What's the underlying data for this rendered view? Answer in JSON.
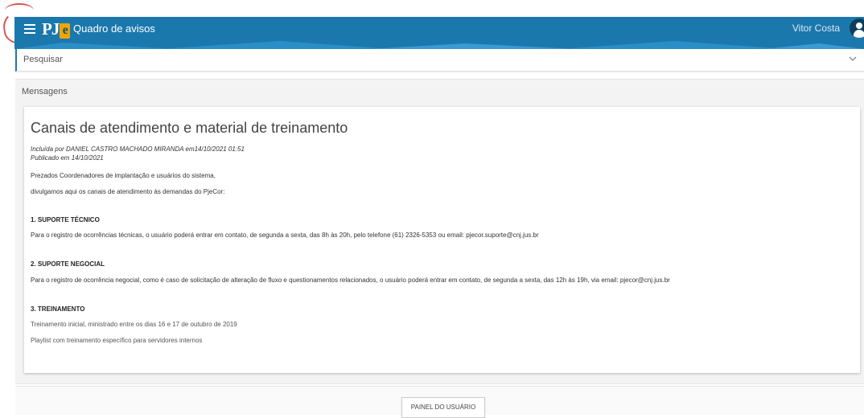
{
  "header": {
    "logo_text": "PJ",
    "logo_e": "e",
    "title": "Quadro de avisos",
    "user_name": "Vitor Costa"
  },
  "search": {
    "label": "Pesquisar"
  },
  "messages": {
    "heading": "Mensagens",
    "card": {
      "title": "Canais de atendimento e material de treinamento",
      "included_by": "Incluída por DANIEL CASTRO MACHADO MIRANDA em14/10/2021 01:51",
      "published": "Publicado em 14/10/2021",
      "intro_1": "Prezados Coordenadores de implantação e usuários do sistema,",
      "intro_2": "divulgamos aqui os canais de atendimento às demandas do PjeCor:",
      "sections": [
        {
          "heading": "1. SUPORTE TÉCNICO",
          "text": "Para o registro de ocorrências técnicas, o usuário poderá entrar em contato, de segunda a sexta, das 8h às 20h, pelo telefone (61) 2326-5353 ou email: pjecor.suporte@cnj.jus.br"
        },
        {
          "heading": "2. SUPORTE NEGOCIAL",
          "text": "Para o registro de ocorrência negocial, como é caso de solicitação de alteração de fluxo e questionamentos relacionados, o usuário poderá entrar em contato, de segunda a sexta, das 12h às 19h, via email: pjecor@cnj.jus.br"
        },
        {
          "heading": "3. TREINAMENTO",
          "links": [
            "Treinamento inicial, ministrado entre os dias 16 e 17 de outubro de 2019",
            "Playlist com treinamento específico para servidores internos"
          ]
        }
      ]
    }
  },
  "footer": {
    "button_label": "PAINEL DO USUÁRIO"
  }
}
